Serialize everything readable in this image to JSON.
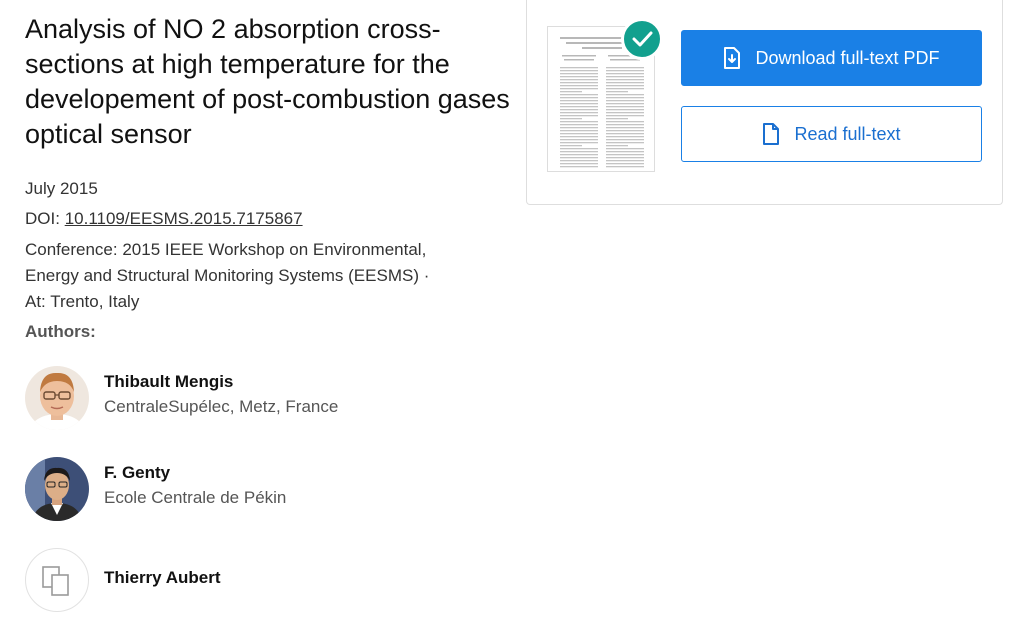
{
  "paper": {
    "title": "Analysis of NO 2 absorption cross-sections at high temperature for the developement of post-combustion gases optical sensor",
    "date": "July 2015",
    "doi_label": "DOI:",
    "doi": "10.1109/EESMS.2015.7175867",
    "conference_line1": "Conference: 2015 IEEE Workshop on Environmental,",
    "conference_line2": "Energy and Structural Monitoring Systems (EESMS) ·",
    "conference_line3": "At: Trento, Italy"
  },
  "authors_heading": "Authors:",
  "authors": [
    {
      "name": "Thibault Mengis",
      "affiliation": "CentraleSupélec, Metz, France"
    },
    {
      "name": "F. Genty",
      "affiliation": "Ecole Centrale de Pékin"
    },
    {
      "name": "Thierry Aubert",
      "affiliation": ""
    }
  ],
  "actions": {
    "download_label": "Download full-text PDF",
    "read_label": "Read full-text"
  },
  "colors": {
    "primary": "#1a80e6",
    "check": "#12a08e"
  },
  "icons": {
    "download": "download-pdf-icon",
    "read": "document-icon",
    "check": "checkmark-icon",
    "placeholder": "placeholder-avatar-icon"
  }
}
